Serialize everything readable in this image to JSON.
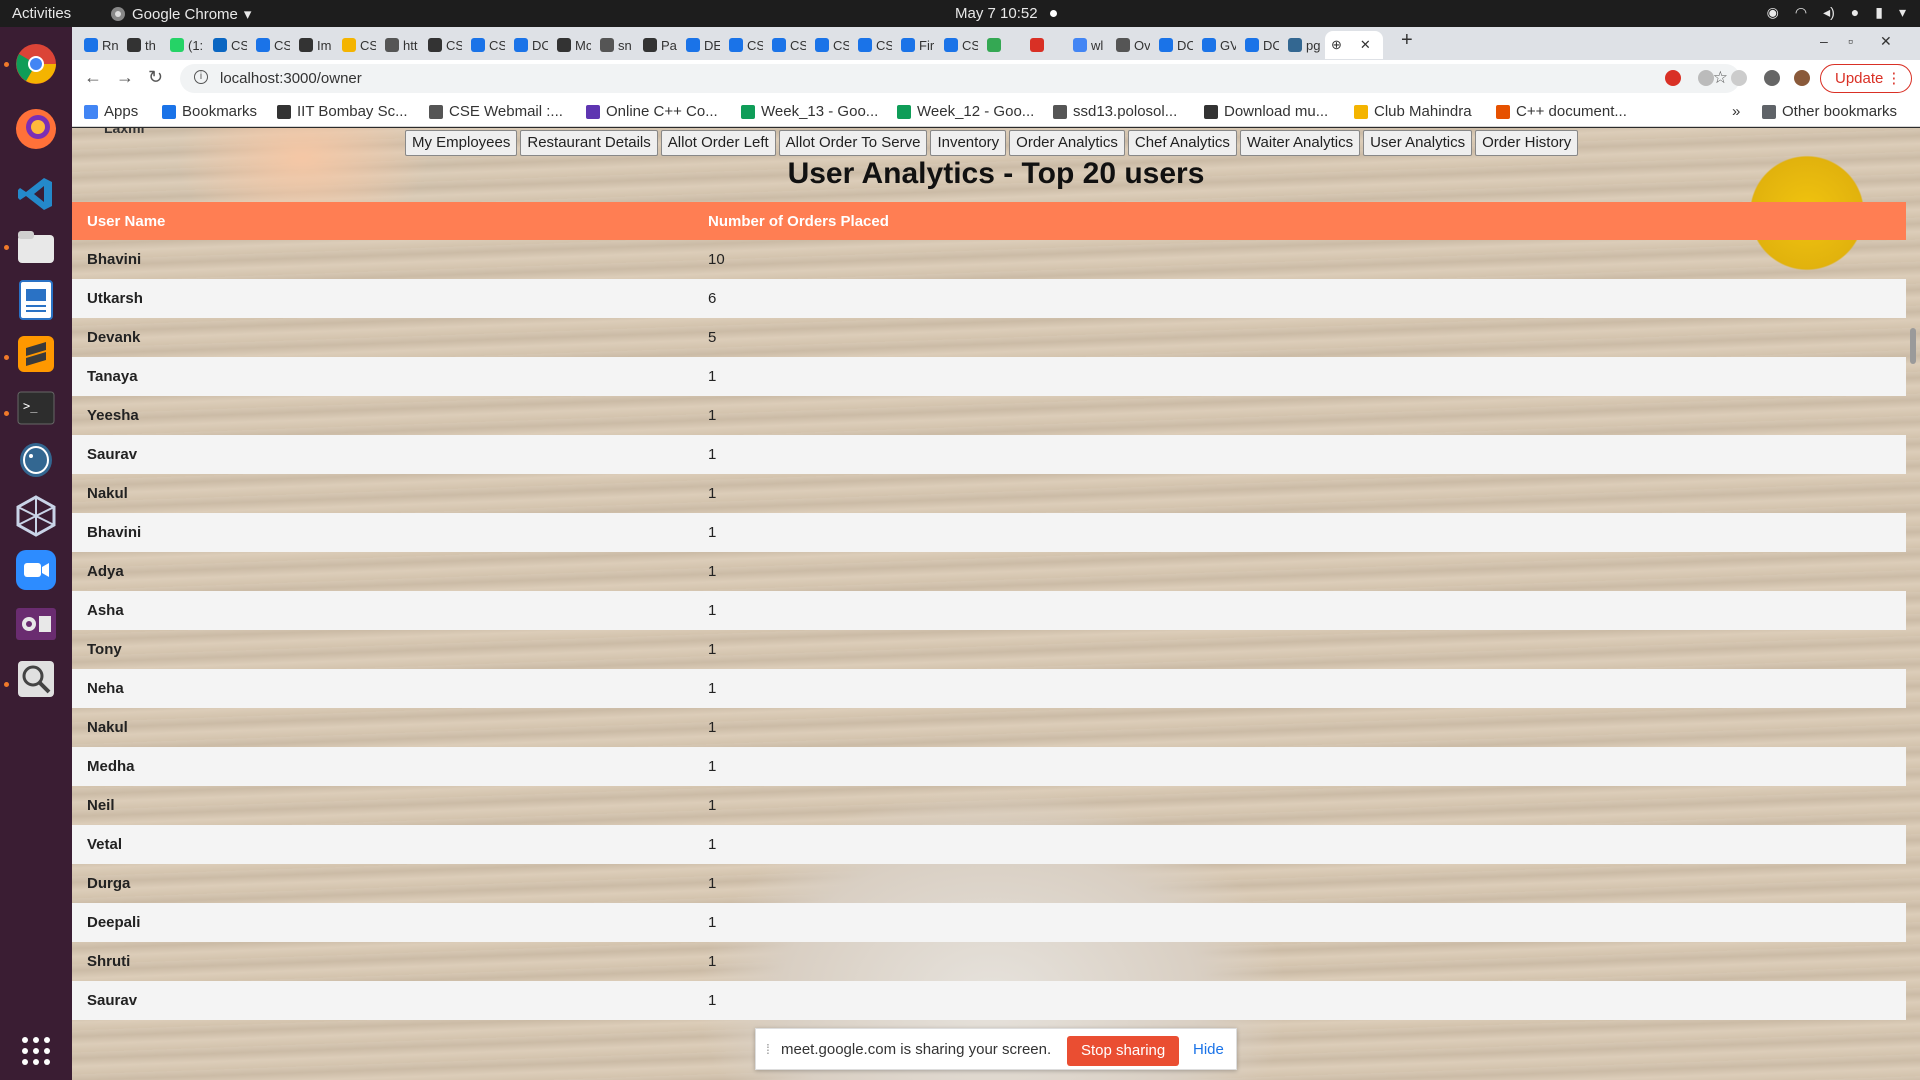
{
  "topbar": {
    "activities": "Activities",
    "app_name": "Google Chrome",
    "app_caret": "▾",
    "datetime": "May 7  10:52"
  },
  "dock": {
    "items": [
      "chrome-icon",
      "firefox-icon",
      "vscode-icon",
      "files-icon",
      "writer-icon",
      "sublime-icon",
      "terminal-icon",
      "postgres-icon",
      "virtualbox-icon",
      "zoom-icon",
      "video-icon",
      "search-icon"
    ],
    "apps_grid_icon": "show-applications-icon"
  },
  "tabs": [
    {
      "label": "Rn",
      "color": "#1a73e8"
    },
    {
      "label": "th",
      "color": "#333333"
    },
    {
      "label": "(1:",
      "color": "#25d366"
    },
    {
      "label": "CS",
      "color": "#0a66c2"
    },
    {
      "label": "CS",
      "color": "#1a73e8"
    },
    {
      "label": "Im",
      "color": "#333333"
    },
    {
      "label": "CS",
      "color": "#f4b400"
    },
    {
      "label": "htt",
      "color": "#555555"
    },
    {
      "label": "CS",
      "color": "#333333"
    },
    {
      "label": "CS",
      "color": "#1a73e8"
    },
    {
      "label": "DC",
      "color": "#1a73e8"
    },
    {
      "label": "Mc",
      "color": "#333333"
    },
    {
      "label": "sn",
      "color": "#555555"
    },
    {
      "label": "Pa",
      "color": "#333333"
    },
    {
      "label": "DE",
      "color": "#1a73e8"
    },
    {
      "label": "CS",
      "color": "#1a73e8"
    },
    {
      "label": "CS",
      "color": "#1a73e8"
    },
    {
      "label": "CS",
      "color": "#1a73e8"
    },
    {
      "label": "CS",
      "color": "#1a73e8"
    },
    {
      "label": "Fir",
      "color": "#1a73e8"
    },
    {
      "label": "CS",
      "color": "#1a73e8"
    },
    {
      "label": "",
      "color": "#34a853"
    },
    {
      "label": "",
      "color": "#d93025"
    },
    {
      "label": "wl",
      "color": "#4285f4"
    },
    {
      "label": "Ov",
      "color": "#555555"
    },
    {
      "label": "DC",
      "color": "#1a73e8"
    },
    {
      "label": "GV",
      "color": "#1a73e8"
    },
    {
      "label": "DC",
      "color": "#1a73e8"
    },
    {
      "label": "pg",
      "color": "#336791"
    }
  ],
  "active_tab": {
    "close": "✕"
  },
  "new_tab": "+",
  "browser": {
    "url": "localhost:3000/owner",
    "update_label": "Update",
    "kebab": "⋮",
    "star": "☆"
  },
  "bookmarks": {
    "items": [
      {
        "label": "Apps",
        "color": "#4285f4"
      },
      {
        "label": "Bookmarks",
        "color": "#1a73e8"
      },
      {
        "label": "IIT Bombay Sc...",
        "color": "#333333"
      },
      {
        "label": "CSE Webmail :...",
        "color": "#555555"
      },
      {
        "label": "Online C++ Co...",
        "color": "#5e35b1"
      },
      {
        "label": "Week_13 - Goo...",
        "color": "#0f9d58"
      },
      {
        "label": "Week_12 - Goo...",
        "color": "#0f9d58"
      },
      {
        "label": "ssd13.polosol...",
        "color": "#555555"
      },
      {
        "label": "Download mu...",
        "color": "#333333"
      },
      {
        "label": "Club Mahindra",
        "color": "#f4b400"
      },
      {
        "label": "C++ document...",
        "color": "#e65100"
      }
    ],
    "overflow": "»",
    "other": "Other bookmarks"
  },
  "page": {
    "partial_prev_row": "Laxmi",
    "nav": [
      "My Employees",
      "Restaurant Details",
      "Allot Order Left",
      "Allot Order To Serve",
      "Inventory",
      "Order Analytics",
      "Chef Analytics",
      "Waiter Analytics",
      "User Analytics",
      "Order History"
    ],
    "heading": "User Analytics - Top 20 users",
    "table": {
      "headers": [
        "User Name",
        "Number of Orders Placed"
      ],
      "rows": [
        [
          "Bhavini",
          "10"
        ],
        [
          "Utkarsh",
          "6"
        ],
        [
          "Devank",
          "5"
        ],
        [
          "Tanaya",
          "1"
        ],
        [
          "Yeesha",
          "1"
        ],
        [
          "Saurav",
          "1"
        ],
        [
          "Nakul",
          "1"
        ],
        [
          "Bhavini",
          "1"
        ],
        [
          "Adya",
          "1"
        ],
        [
          "Asha",
          "1"
        ],
        [
          "Tony",
          "1"
        ],
        [
          "Neha",
          "1"
        ],
        [
          "Nakul",
          "1"
        ],
        [
          "Medha",
          "1"
        ],
        [
          "Neil",
          "1"
        ],
        [
          "Vetal",
          "1"
        ],
        [
          "Durga",
          "1"
        ],
        [
          "Deepali",
          "1"
        ],
        [
          "Shruti",
          "1"
        ],
        [
          "Saurav",
          "1"
        ]
      ]
    }
  },
  "share_bar": {
    "message": "meet.google.com is sharing your screen.",
    "stop": "Stop sharing",
    "hide": "Hide"
  }
}
